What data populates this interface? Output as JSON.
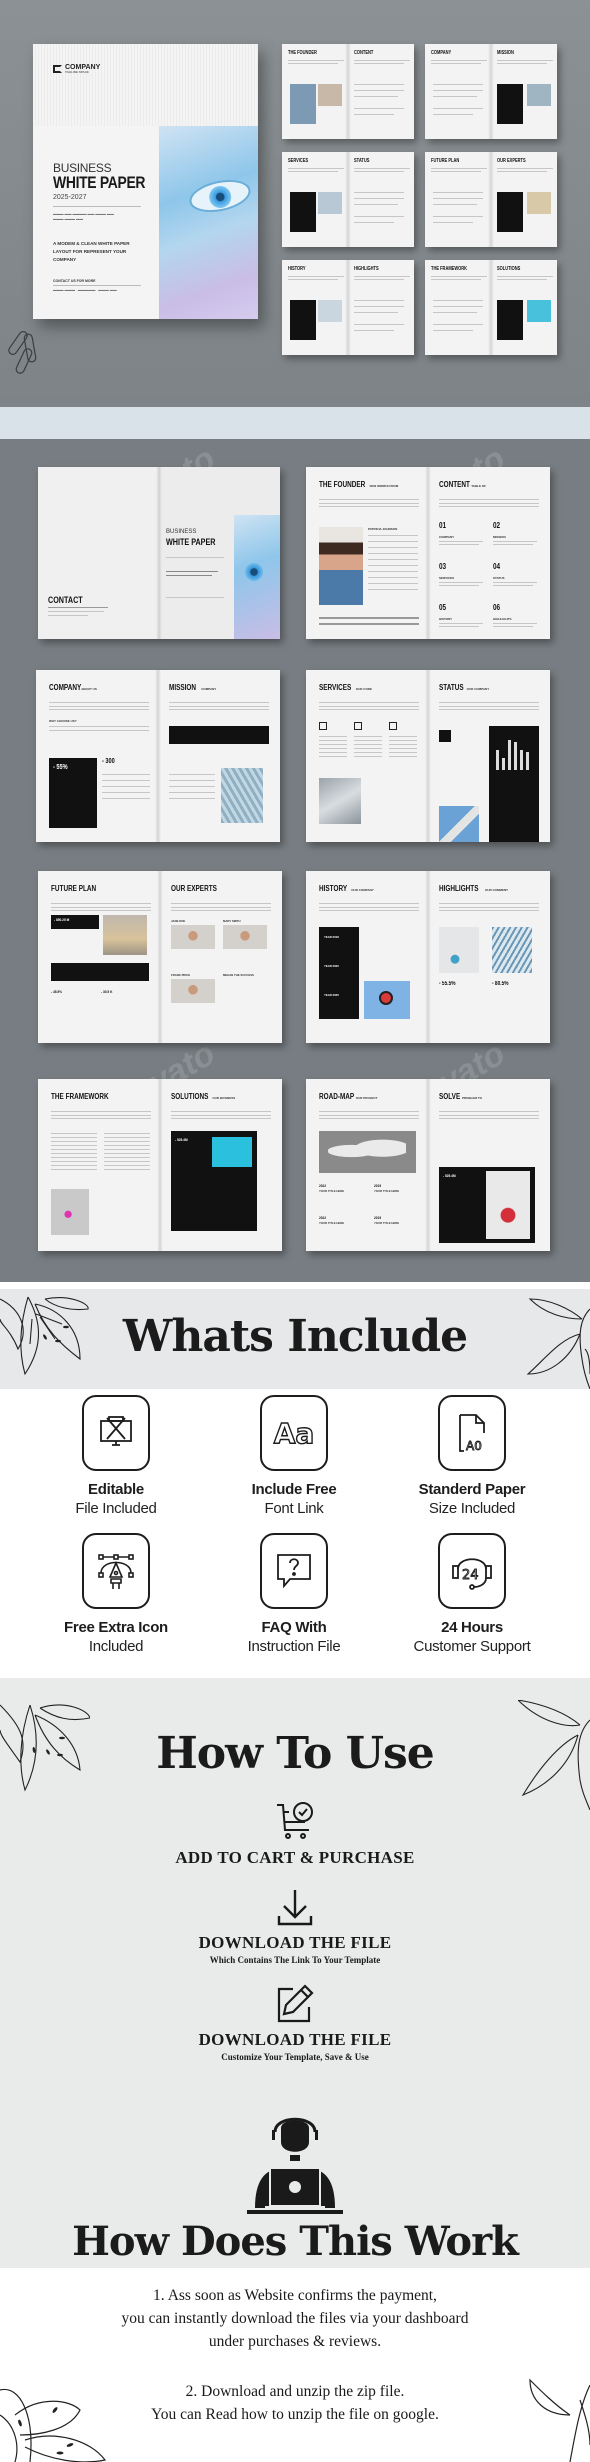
{
  "hero": {
    "cover": {
      "logo_name": "COMPANY",
      "logo_tagline": "TAGLINE SPACE",
      "title_line1": "BUSINESS",
      "title_line2": "WHITE PAPER",
      "years": "2025-2027",
      "tagline": "A MODEM & CLEAN WHITE PAPER LAYOUT FOR REPRESENT YOUR COMPANY",
      "contact_label": "CONTACT US FOR MORE"
    },
    "thumb_spreads": [
      {
        "left": "THE FOUNDER",
        "right": "CONTENT"
      },
      {
        "left": "COMPANY",
        "right": "MISSION"
      },
      {
        "left": "SERVICES",
        "right": "STATUS"
      },
      {
        "left": "FUTURE PLAN",
        "right": "OUR EXPERTS"
      },
      {
        "left": "HISTORY",
        "right": "HIGHLIGHTS"
      },
      {
        "left": "THE FRAMEWORK",
        "right": "SOLUTIONS"
      }
    ]
  },
  "gallery": {
    "watermark": "envato",
    "spreads": [
      {
        "left_title": "CONTACT",
        "left_sub": "",
        "right_title": "WHITE PAPER",
        "right_sub": "BUSINESS",
        "kind": "cover"
      },
      {
        "left_title": "THE FOUNDER",
        "left_sub": "FEW WORDS FROM",
        "right_title": "CONTENT",
        "right_sub": "TABLE OF",
        "kind": "founder",
        "founder_name": "PATRICIA JOHNSON",
        "toc": [
          {
            "num": "01",
            "label": "COMPANY"
          },
          {
            "num": "02",
            "label": "MISSION"
          },
          {
            "num": "03",
            "label": "SERVICES"
          },
          {
            "num": "04",
            "label": "STATUS"
          },
          {
            "num": "05",
            "label": "HISTORY"
          },
          {
            "num": "06",
            "label": "HIGHLIGHTS"
          }
        ]
      },
      {
        "left_title": "COMPANY",
        "left_sub": "ABOUT US",
        "right_title": "MISSION",
        "right_sub": "COMPANY",
        "kind": "company",
        "stat1": "- 55%",
        "stat2": "- 300",
        "why": "WHY CHOOSE US?"
      },
      {
        "left_title": "SERVICES",
        "left_sub": "OUR CORE",
        "right_title": "STATUS",
        "right_sub": "OUR COMPANY",
        "kind": "services"
      },
      {
        "left_title": "FUTURE PLAN",
        "left_sub": "",
        "right_title": "OUR EXPERTS",
        "right_sub": "",
        "kind": "future",
        "stat1": "- 850.25 M",
        "stat2": "- 45.5%",
        "stat3": "- 30.5 K",
        "experts": [
          "JANE DOE",
          "MARY SMITH",
          "FRANK PRICE",
          "MEHAB THE SUCCESS"
        ]
      },
      {
        "left_title": "HISTORY",
        "left_sub": "OUR COMPANY",
        "right_title": "HIGHLIGHTS",
        "right_sub": "OUR COMMENT",
        "kind": "history",
        "years": [
          "YEAR 2018",
          "YEAR 2020",
          "YEAR 2025"
        ],
        "stat1": "- 55.5%",
        "stat2": "- 80.5%"
      },
      {
        "left_title": "THE FRAMEWORK",
        "left_sub": "",
        "right_title": "SOLUTIONS",
        "right_sub": "OUR BUSINESS",
        "kind": "framework",
        "stat1": "- 525.4M"
      },
      {
        "left_title": "ROAD-MAP",
        "left_sub": "OUR PROJECT",
        "right_title": "SOLVE",
        "right_sub": "PROBLEM TO",
        "kind": "roadmap",
        "years": [
          "2022",
          "2019",
          "2022",
          "2019"
        ],
        "item_title": "YOUR TITLE HERE",
        "stat1": "- 525.4M"
      }
    ]
  },
  "whats_include": {
    "heading": "Whats Include",
    "items": [
      {
        "icon": "editable-design-icon",
        "title": "Editable",
        "subtitle": "File Included"
      },
      {
        "icon": "font-icon",
        "title": "Include Free",
        "subtitle": "Font Link"
      },
      {
        "icon": "paper-size-icon",
        "title": "Standerd Paper",
        "subtitle": "Size Included"
      },
      {
        "icon": "pen-tool-icon",
        "title": "Free Extra Icon",
        "subtitle": "Included"
      },
      {
        "icon": "faq-chat-icon",
        "title": "FAQ With",
        "subtitle": "Instruction File"
      },
      {
        "icon": "support-24h-icon",
        "title": "24 Hours",
        "subtitle": "Customer Support"
      }
    ],
    "font_glyph": "Aa",
    "paper_glyph": "A0",
    "support_glyph": "24"
  },
  "how_to_use": {
    "heading": "How To Use",
    "steps": [
      {
        "icon": "cart-check-icon",
        "title": "ADD TO CART & PURCHASE",
        "subtitle": ""
      },
      {
        "icon": "download-icon",
        "title": "DOWNLOAD THE FILE",
        "subtitle": "Which Contains The Link To Your Template"
      },
      {
        "icon": "edit-icon",
        "title": "DOWNLOAD THE FILE",
        "subtitle": "Customize Your Template, Save & Use"
      }
    ]
  },
  "how_does_this_work": {
    "heading": "How Does This Work",
    "paragraphs": [
      [
        "1. Ass soon as Website confirms the payment,",
        "you can instantly download the files via your dashboard",
        "under purchases & reviews."
      ],
      [
        "2. Download and unzip the zip file.",
        "You can Read how to unzip the file on google."
      ]
    ]
  }
}
